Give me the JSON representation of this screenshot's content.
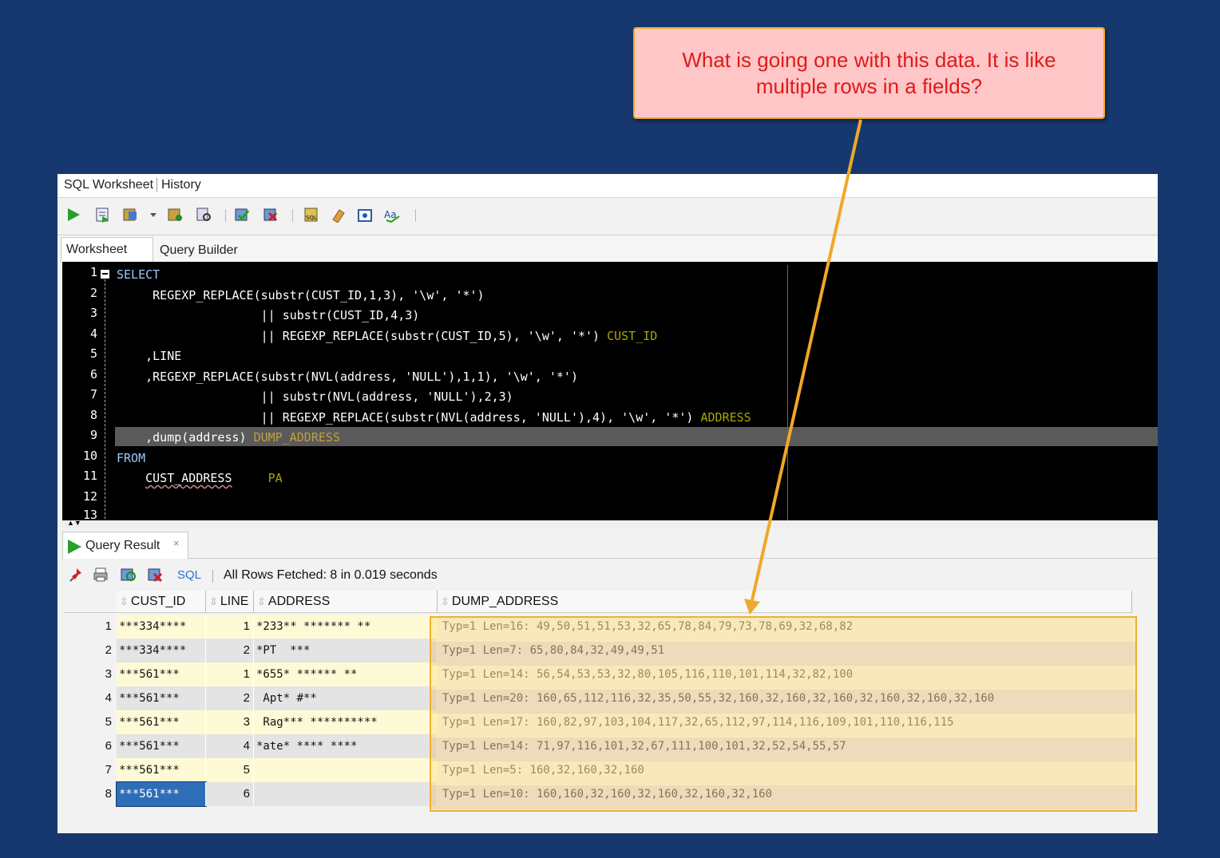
{
  "callout": {
    "line1": "What is going one with this data.  It is like",
    "line2": "multiple rows in a fields?"
  },
  "window": {
    "tabs": [
      "SQL Worksheet",
      "History"
    ],
    "subtabs": [
      "Worksheet",
      "Query Builder"
    ]
  },
  "editor": {
    "line_numbers": [
      "1",
      "2",
      "3",
      "4",
      "5",
      "6",
      "7",
      "8",
      "9",
      "10",
      "11",
      "12",
      "13"
    ],
    "lines": [
      {
        "p1": "SELECT"
      },
      {
        "p1": "     REGEXP_REPLACE(substr(CUST_ID,1,3), '\\w', '*')"
      },
      {
        "p1": "                    || substr(CUST_ID,4,3)"
      },
      {
        "p1": "                    || REGEXP_REPLACE(substr(CUST_ID,5), '\\w', '*') ",
        "alias": "CUST_ID"
      },
      {
        "p1": "    ,LINE"
      },
      {
        "p1": "    ,REGEXP_REPLACE(substr(NVL(address, 'NULL'),1,1), '\\w', '*')"
      },
      {
        "p1": "                    || substr(NVL(address, 'NULL'),2,3)"
      },
      {
        "p1": "                    || REGEXP_REPLACE(substr(NVL(address, 'NULL'),4), '\\w', '*') ",
        "alias": "ADDRESS"
      },
      {
        "p1": "    ,dump(address) ",
        "alias": "DUMP_ADDRESS"
      },
      {
        "p1": "FROM"
      },
      {
        "p1": "    ",
        "table": "CUST_ADDRESS",
        "p2": "     ",
        "alias": "PA"
      },
      {
        "p1": ""
      }
    ]
  },
  "results": {
    "tab_label": "Query Result",
    "close": "×",
    "sql_link": "SQL",
    "status": "All Rows Fetched: 8 in 0.019 seconds",
    "columns": [
      "CUST_ID",
      "LINE",
      "ADDRESS",
      "DUMP_ADDRESS"
    ],
    "rows": [
      {
        "n": "1",
        "cust_id": "***334****",
        "line": "1",
        "address": "*233** ******* **",
        "dump": "Typ=1 Len=16: 49,50,51,51,53,32,65,78,84,79,73,78,69,32,68,82"
      },
      {
        "n": "2",
        "cust_id": "***334****",
        "line": "2",
        "address": "*PT  ***",
        "dump": "Typ=1 Len=7: 65,80,84,32,49,49,51"
      },
      {
        "n": "3",
        "cust_id": "***561***",
        "line": "1",
        "address": "*655* ****** **",
        "dump": "Typ=1 Len=14: 56,54,53,53,32,80,105,116,110,101,114,32,82,100"
      },
      {
        "n": "4",
        "cust_id": "***561***",
        "line": "2",
        "address": " Apt* #**",
        "dump": "Typ=1 Len=20: 160,65,112,116,32,35,50,55,32,160,32,160,32,160,32,160,32,160,32,160"
      },
      {
        "n": "5",
        "cust_id": "***561***",
        "line": "3",
        "address": " Rag*** **********",
        "dump": "Typ=1 Len=17: 160,82,97,103,104,117,32,65,112,97,114,116,109,101,110,116,115"
      },
      {
        "n": "6",
        "cust_id": "***561***",
        "line": "4",
        "address": "*ate* **** ****",
        "dump": "Typ=1 Len=14: 71,97,116,101,32,67,111,100,101,32,52,54,55,57"
      },
      {
        "n": "7",
        "cust_id": "***561***",
        "line": "5",
        "address": "",
        "dump": "Typ=1 Len=5: 160,32,160,32,160"
      },
      {
        "n": "8",
        "cust_id": "***561***",
        "line": "6",
        "address": "",
        "dump": "Typ=1 Len=10: 160,160,32,160,32,160,32,160,32,160"
      }
    ]
  },
  "colors": {
    "background": "#17386f",
    "callout_fill": "#ffc7c7",
    "callout_text": "#e01a1a",
    "highlight": "#f0b030",
    "selection": "#2e6db8"
  }
}
